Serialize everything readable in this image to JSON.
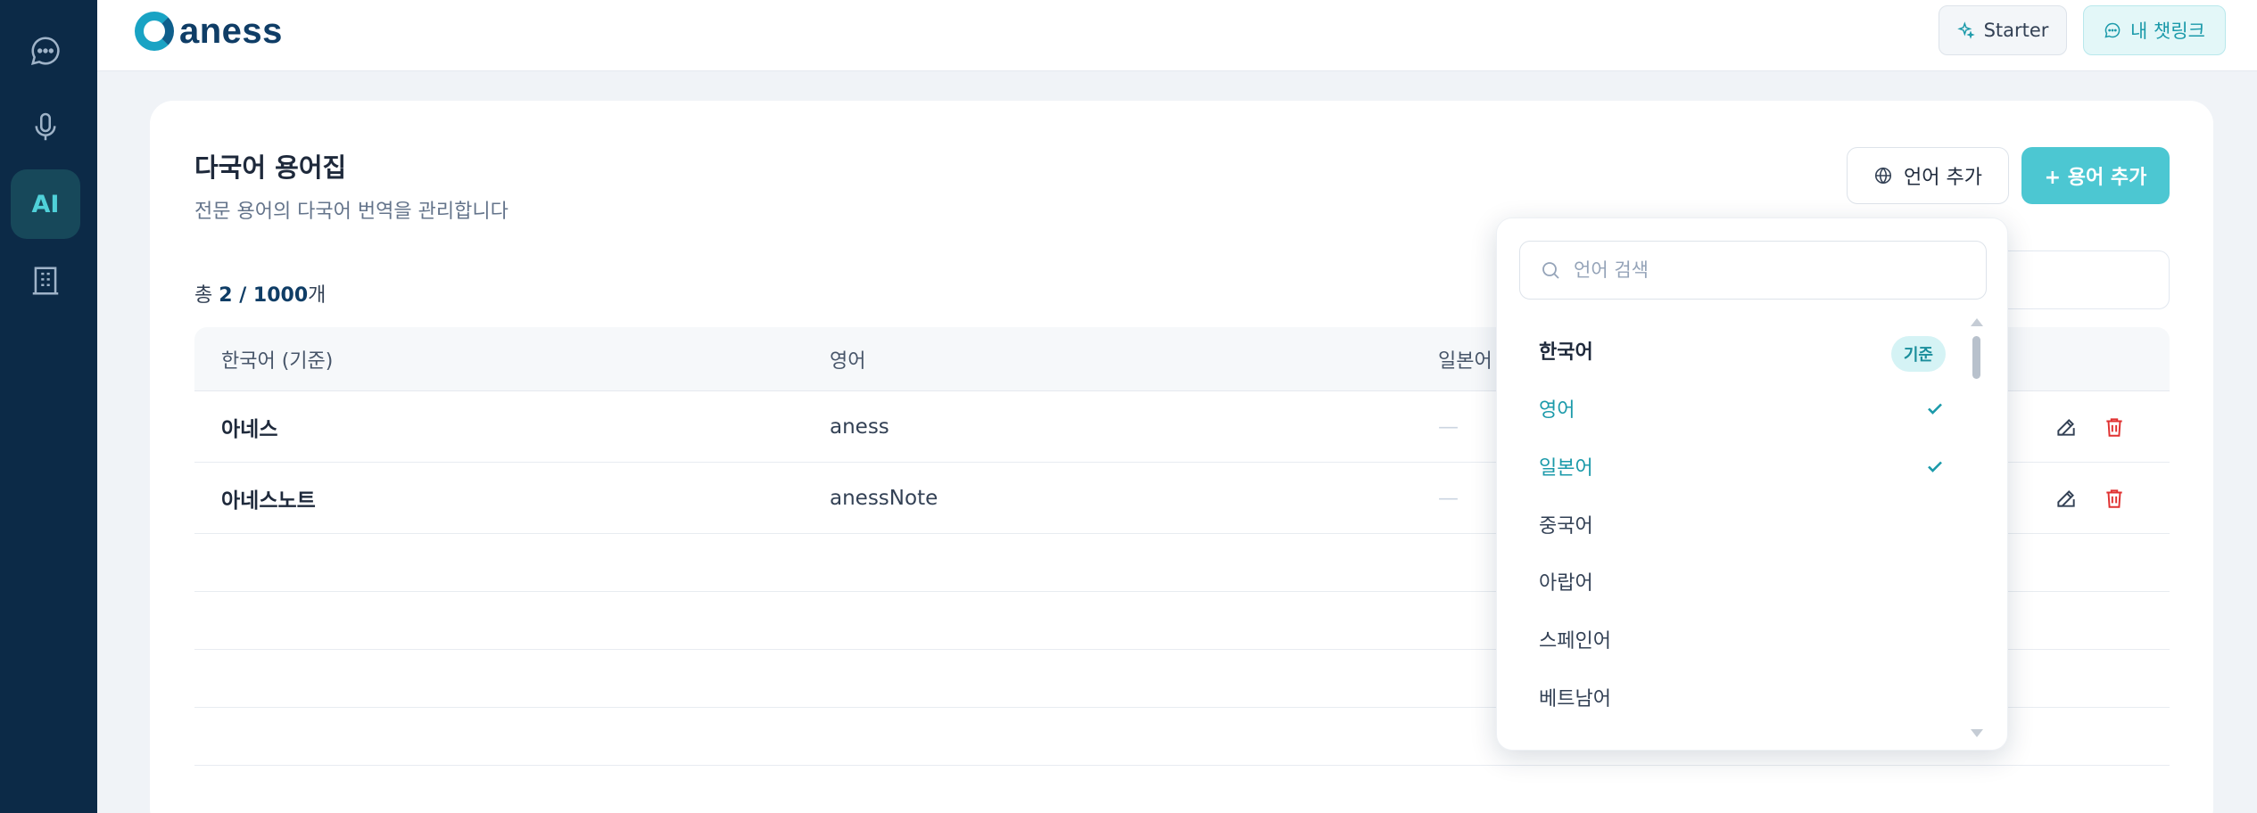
{
  "header": {
    "logo_text": "aness",
    "starter_label": "Starter",
    "chatlink_label": "내 챗링크"
  },
  "sidebar": {
    "items": [
      {
        "icon": "chat-icon"
      },
      {
        "icon": "microphone-icon"
      },
      {
        "label": "AI",
        "active": true
      },
      {
        "icon": "building-icon"
      }
    ]
  },
  "page": {
    "title": "다국어 용어집",
    "subtitle": "전문 용어의 다국어 번역을 관리합니다",
    "count_prefix": "총 ",
    "count_value": "2 / 1000",
    "count_suffix": "개",
    "add_language_label": "언어 추가",
    "add_term_label": "+ 용어 추가"
  },
  "table": {
    "columns": [
      "한국어 (기준)",
      "영어",
      "일본어"
    ],
    "rows": [
      {
        "ko": "아네스",
        "en": "aness",
        "ja": "—"
      },
      {
        "ko": "아네스노트",
        "en": "anessNote",
        "ja": "—"
      }
    ]
  },
  "dropdown": {
    "search_placeholder": "언어 검색",
    "base_badge": "기준",
    "items": [
      {
        "label": "한국어",
        "state": "base"
      },
      {
        "label": "영어",
        "state": "selected"
      },
      {
        "label": "일본어",
        "state": "selected"
      },
      {
        "label": "중국어",
        "state": "none"
      },
      {
        "label": "아랍어",
        "state": "none"
      },
      {
        "label": "스페인어",
        "state": "none"
      },
      {
        "label": "베트남어",
        "state": "none"
      }
    ]
  },
  "colors": {
    "sidebar_bg": "#0c2a47",
    "accent": "#4cc7d2",
    "accent_text": "#1b9aaa",
    "delete_red": "#e03131"
  }
}
